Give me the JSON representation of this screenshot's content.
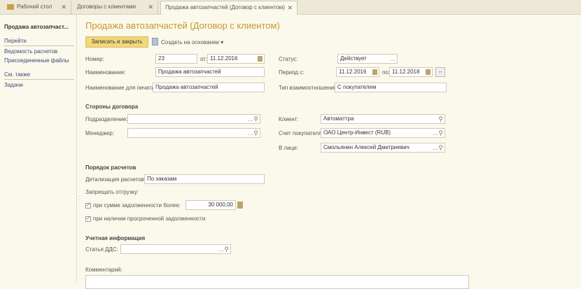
{
  "tabs": [
    {
      "label": "Рабочий стол",
      "icon": "home-icon"
    },
    {
      "label": "Договоры с клиентами"
    },
    {
      "label": "Продажа автозапчастей (Договор с клиентом)",
      "active": true
    }
  ],
  "close_glyph": "✕",
  "sidebar": {
    "title": "Продажа автозапчаст...",
    "goto": "Перейти",
    "items": [
      "Ведомость расчетов",
      "Присоединенные файлы"
    ],
    "see_also": "См. также",
    "see_items": [
      "Задачи"
    ]
  },
  "form": {
    "title": "Продажа автозапчастей (Договор с клиентом)",
    "save_close": "Записать и закрыть",
    "create_based": "Создать на основании ▾",
    "number_label": "Номер:",
    "number": "23",
    "from_label": "от:",
    "date": "11.12.2016",
    "name_label": "Наименование:",
    "name": "Продажа автозапчастей",
    "print_name_label": "Наименование для печати:",
    "print_name": "Продажа автозапчастей",
    "status_label": "Статус:",
    "status": "Действует",
    "period_label": "Период с:",
    "period_from": "11.12.2016",
    "to_label": "по:",
    "period_to": "11.12.2018",
    "relation_label": "Тип взаимоотношений:",
    "relation": "С покупателем",
    "parties_header": "Стороны договора",
    "division_label": "Подразделение:",
    "division": "",
    "manager_label": "Менеджер:",
    "manager": "",
    "client_label": "Клиент:",
    "client": "Автоматтра",
    "account_label": "Счет покупателя:",
    "account": "ОАО Центр-Инвест (RUB)",
    "person_label": "В лице:",
    "person": "Смольянин Алексей Дмитриевич",
    "payments_header": "Порядок расчетов",
    "detail_label": "Детализация расчетов:",
    "detail": "По заказам",
    "forbid_label": "Запрещать отгрузку:",
    "debt_check_label": "при сумме задолженности более:",
    "debt_checked": true,
    "debt_amount": "30 000,00",
    "overdue_check_label": "при наличии просроченной задолженности",
    "overdue_checked": true,
    "accounting_header": "Учетная информация",
    "dds_label": "Статья ДДС:",
    "dds": "",
    "comment_label": "Комментарий:"
  },
  "colors": {
    "accent": "#c8962a",
    "button": "#f3d77b",
    "background": "#fbf9ec"
  }
}
